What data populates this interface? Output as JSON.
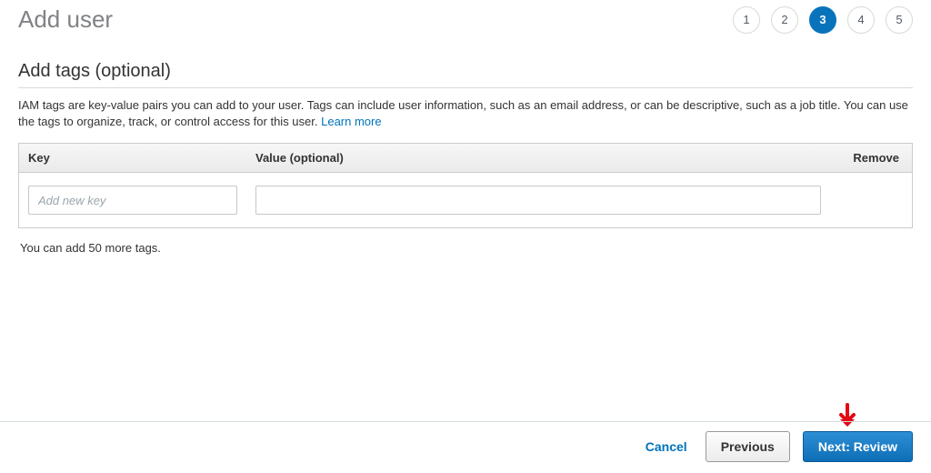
{
  "header": {
    "title": "Add user",
    "steps": [
      "1",
      "2",
      "3",
      "4",
      "5"
    ],
    "active_step_index": 2
  },
  "section": {
    "title": "Add tags (optional)",
    "description_1": "IAM tags are key-value pairs you can add to your user. Tags can include user information, such as an email address, or can be descriptive, such as a job title. You can use the tags to organize, track, or control access for this user. ",
    "learn_more": "Learn more"
  },
  "table": {
    "head_key": "Key",
    "head_value": "Value (optional)",
    "head_remove": "Remove",
    "key_placeholder": "Add new key",
    "value_placeholder": "",
    "hint": "You can add 50 more tags."
  },
  "footer": {
    "cancel": "Cancel",
    "previous": "Previous",
    "next": "Next: Review"
  }
}
